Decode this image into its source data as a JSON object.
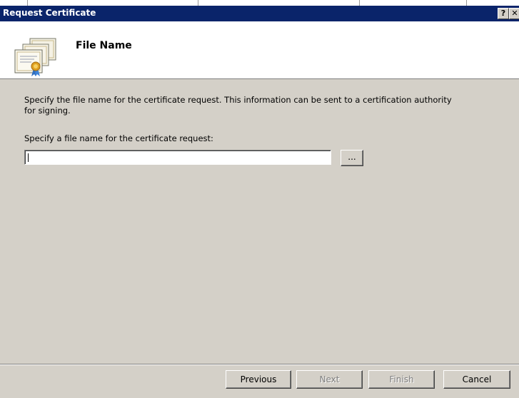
{
  "window": {
    "title": "Request Certificate",
    "help_button": "?",
    "close_button": "✕"
  },
  "header": {
    "title": "File Name"
  },
  "content": {
    "description": "Specify the file name for the certificate request. This information can be sent to a certification authority for signing.",
    "prompt": "Specify a file name for the certificate request:",
    "file_name_value": "",
    "browse_label": "..."
  },
  "footer": {
    "previous": "Previous",
    "next": "Next",
    "finish": "Finish",
    "cancel": "Cancel"
  },
  "colors": {
    "titlebar": "#0a246a",
    "dialog_bg": "#d4d0c8"
  },
  "icons": {
    "header": "certificate-icon"
  }
}
